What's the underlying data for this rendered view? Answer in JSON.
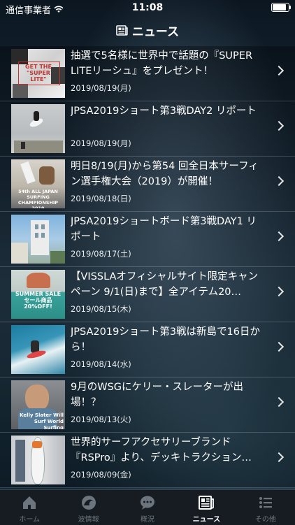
{
  "status_bar": {
    "carrier": "通信事業者",
    "time": "11:08",
    "battery_percent": 85
  },
  "header": {
    "title": "ニュース"
  },
  "news": [
    {
      "title": "抽選で5名様に世界中で話題の『SUPER LITEリーシュ』をプレゼント！",
      "date": "2019/08/19(月)",
      "thumb_text": "GET THE \"SUPER LITE\""
    },
    {
      "title": "JPSA2019ショート第3戦DAY2 リポート",
      "date": "2019/08/19(月)"
    },
    {
      "title": "明日8/19(月)から第54 回全日本サーフィン選手権大会（2019）が開催！",
      "date": "2019/08/18(日)",
      "thumb_text": "54th ALL JAPAN SURFING CHAMPIONSHIP 2019"
    },
    {
      "title": "JPSA2019ショートボード第3戦DAY1 リポート",
      "date": "2019/08/17(土)"
    },
    {
      "title": "【VISSLAオフィシャルサイト限定キャンペーン 9/1(日)まで】全アイテム20…",
      "date": "2019/08/15(木)",
      "thumb_text": "SUMMER SALE セール商品20%OFF!"
    },
    {
      "title": "JPSA2019ショート第3戦は新島で16日から！",
      "date": "2019/08/14(水)"
    },
    {
      "title": "9月のWSGにケリー・スレーターが出場！？",
      "date": "2019/08/13(火)",
      "thumb_text": "Kelly Slater Will Surf World Surfing"
    },
    {
      "title": "世界的サーフアクセサリーブランド『RSPro』より、デッキトラクション…",
      "date": "2019/08/09(金)"
    }
  ],
  "tabs": [
    {
      "label": "ホーム",
      "icon": "home-icon",
      "active": false
    },
    {
      "label": "波情報",
      "icon": "wave-icon",
      "active": false
    },
    {
      "label": "概況",
      "icon": "chat-bubble-icon",
      "active": false
    },
    {
      "label": "ニュース",
      "icon": "newspaper-icon",
      "active": true
    },
    {
      "label": "その他",
      "icon": "list-icon",
      "active": false
    }
  ]
}
